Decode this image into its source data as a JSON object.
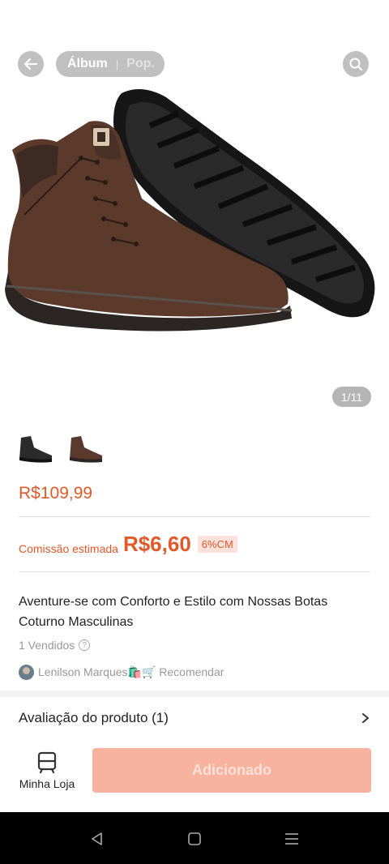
{
  "header": {
    "tabs": [
      {
        "label": "Álbum"
      },
      {
        "label": "Pop."
      }
    ]
  },
  "gallery": {
    "counter": "1/11",
    "thumbnails": [
      {
        "name": "black-boot-thumbnail",
        "color": "#2b2b2b"
      },
      {
        "name": "brown-boot-thumbnail",
        "color": "#5a3a2c"
      }
    ]
  },
  "product": {
    "price": "R$109,99",
    "commission_label": "Comissão estimada",
    "commission_value": "R$6,60",
    "commission_badge": "6%CM",
    "title": "Aventure-se com Conforto e Estilo com Nossas Botas Coturno Masculinas",
    "sold": "1 Vendidos",
    "recommender": "Lenilson Marques🛍️🛒 Recomendar"
  },
  "reviews": {
    "title": "Avaliação do produto (1)"
  },
  "bottom_bar": {
    "store_label": "Minha Loja",
    "added_label": "Adicionado"
  },
  "colors": {
    "accent": "#e0592a",
    "button_disabled": "#f7b3a0",
    "badge_bg": "#fde2dc"
  }
}
